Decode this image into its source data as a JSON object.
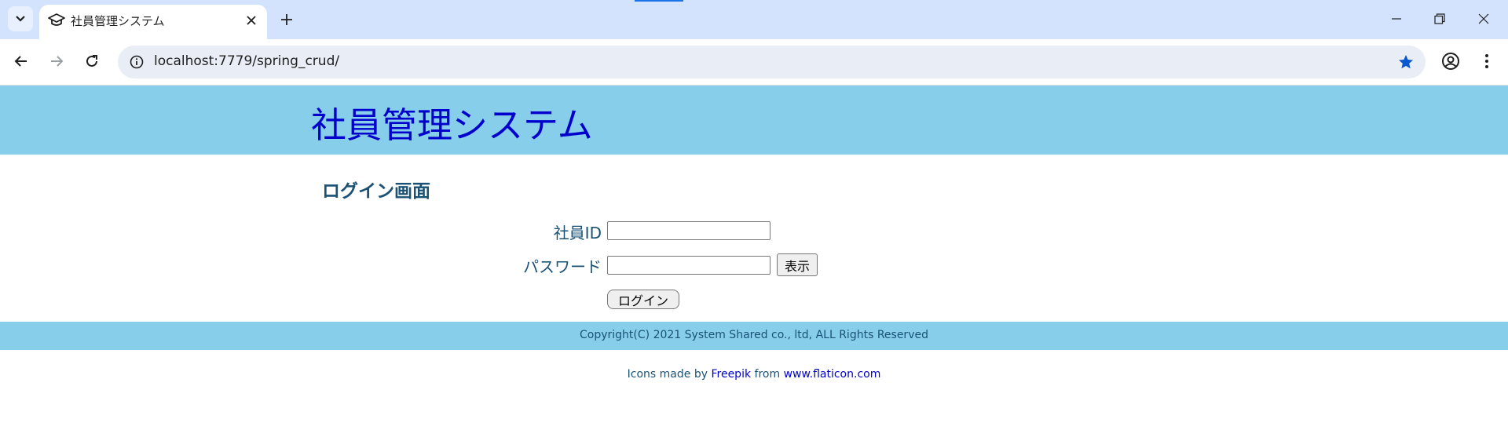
{
  "browser": {
    "tab_title": "社員管理システム",
    "url": "localhost:7779/spring_crud/"
  },
  "app": {
    "title": "社員管理システム",
    "login_heading": "ログイン画面",
    "form": {
      "employee_id_label": "社員ID",
      "employee_id_value": "",
      "password_label": "パスワード",
      "password_value": "",
      "show_button_label": "表示",
      "login_button_label": "ログイン"
    },
    "footer": {
      "copyright": "Copyright(C) 2021 System Shared co., ltd, ALL Rights Reserved"
    },
    "credits": {
      "prefix": "Icons made by",
      "author_link": "Freepik",
      "middle": "from",
      "site_link": "www.flaticon.com"
    }
  },
  "colors": {
    "header_bg": "#87ceeb",
    "title_color": "#0000cd",
    "text_color": "#1a5276",
    "chrome_bg": "#d3e3fd"
  }
}
